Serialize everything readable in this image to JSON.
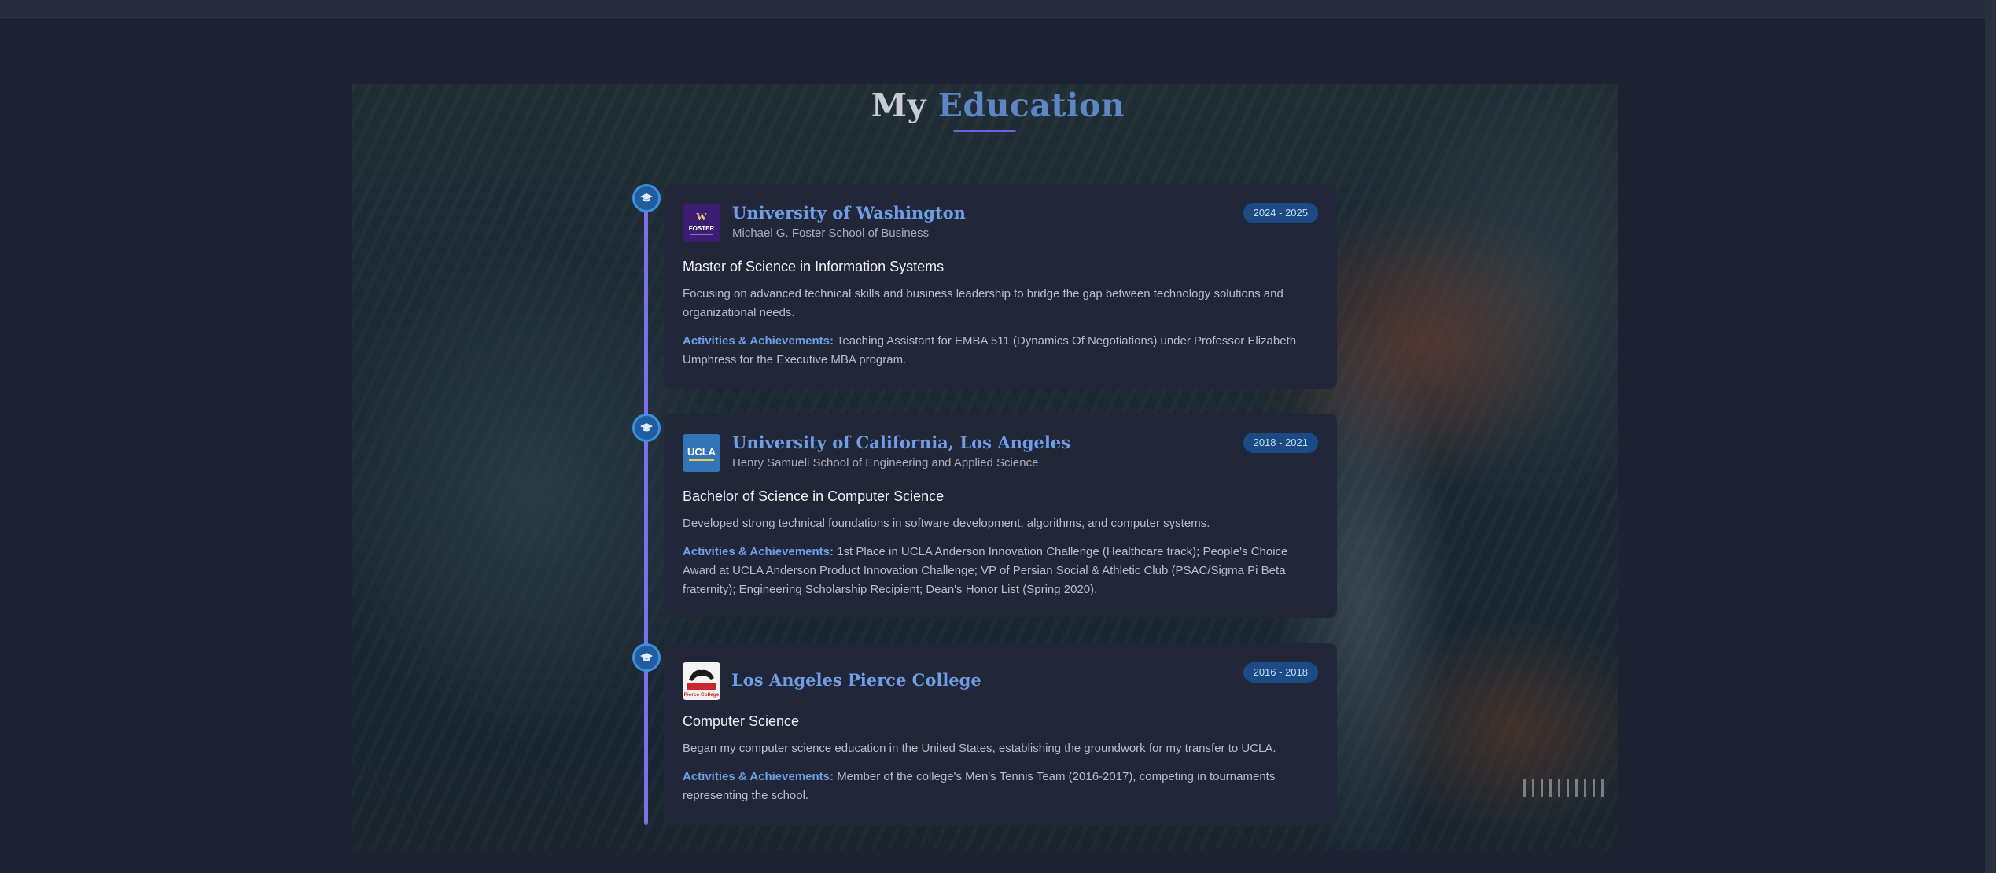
{
  "section": {
    "title_prefix": "My",
    "title_accent": "Education"
  },
  "education": [
    {
      "logo_text": "FOSTER",
      "institution": "University of Washington",
      "school": "Michael G. Foster School of Business",
      "dates": "2024 - 2025",
      "degree": "Master of Science in Information Systems",
      "description": "Focusing on advanced technical skills and business leadership to bridge the gap between technology solutions and organizational needs.",
      "activities_label": "Activities & Achievements:",
      "activities": "Teaching Assistant for EMBA 511 (Dynamics Of Negotiations) under Professor Elizabeth Umphress for the Executive MBA program."
    },
    {
      "logo_text": "UCLA",
      "institution": "University of California, Los Angeles",
      "school": "Henry Samueli School of Engineering and Applied Science",
      "dates": "2018 - 2021",
      "degree": "Bachelor of Science in Computer Science",
      "description": "Developed strong technical foundations in software development, algorithms, and computer systems.",
      "activities_label": "Activities & Achievements:",
      "activities": "1st Place in UCLA Anderson Innovation Challenge (Healthcare track); People's Choice Award at UCLA Anderson Product Innovation Challenge; VP of Persian Social & Athletic Club (PSAC/Sigma Pi Beta fraternity); Engineering Scholarship Recipient; Dean's Honor List (Spring 2020)."
    },
    {
      "logo_text": "Pierce College",
      "institution": "Los Angeles Pierce College",
      "school": "",
      "dates": "2016 - 2018",
      "degree": "Computer Science",
      "description": "Began my computer science education in the United States, establishing the groundwork for my transfer to UCLA.",
      "activities_label": "Activities & Achievements:",
      "activities": "Member of the college's Men's Tennis Team (2016-2017), competing in tournaments representing the school."
    }
  ],
  "icons": {
    "timeline_node": "graduation-cap-icon"
  },
  "colors": {
    "accent_blue": "#6f9ee6",
    "timeline": "#7b70e8",
    "card_bg": "#222639",
    "badge_bg": "#1c4a85"
  }
}
